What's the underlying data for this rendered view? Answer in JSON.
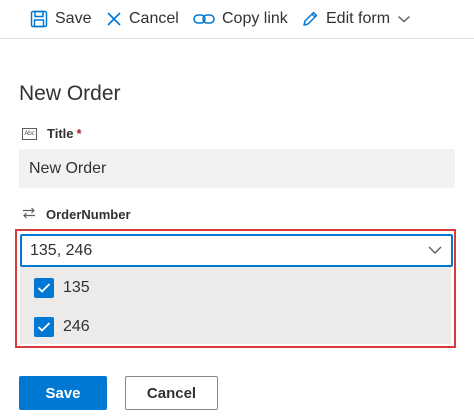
{
  "toolbar": {
    "save_label": "Save",
    "cancel_label": "Cancel",
    "copy_link_label": "Copy link",
    "edit_form_label": "Edit form"
  },
  "form": {
    "title": "New Order",
    "fields": {
      "title": {
        "label": "Title",
        "required_mark": "*",
        "value": "New Order",
        "icon": "text-field-icon"
      },
      "order_number": {
        "label": "OrderNumber",
        "icon": "lookup-icon",
        "value": "135, 246",
        "options": [
          {
            "label": "135",
            "checked": true
          },
          {
            "label": "246",
            "checked": true
          }
        ]
      }
    }
  },
  "actions": {
    "save_label": "Save",
    "cancel_label": "Cancel"
  },
  "colors": {
    "accent": "#0078d4",
    "highlight": "#d83b3b",
    "required": "#a4262c"
  }
}
